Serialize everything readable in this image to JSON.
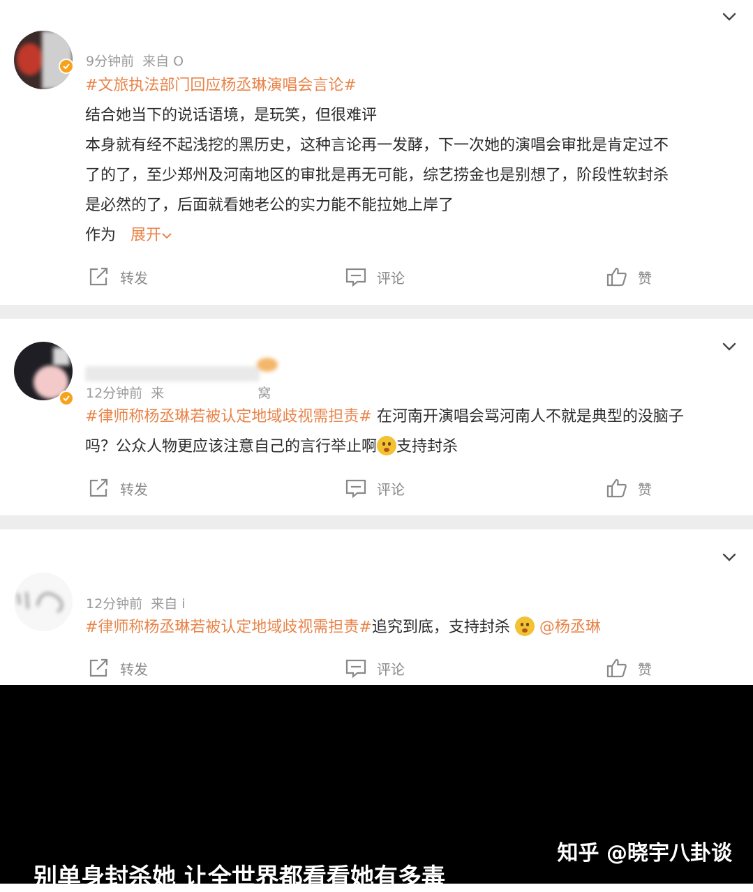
{
  "comments": [
    {
      "time": "9分钟前",
      "source": "来自 O",
      "hashtag": "#文旅执法部门回应杨丞琳演唱会言论#",
      "lines": [
        "结合她当下的说话语境，是玩笑，但很难评",
        "本身就有经不起浅挖的黑历史，这种言论再一发酵，下一次她的演唱会审批是肯定过不",
        "了的了，至少郑州及河南地区的审批是再无可能，综艺捞金也是别想了，阶段性软封杀",
        "是必然的了，后面就看她老公的实力能不能拉她上岸了"
      ],
      "truncated_prefix": "作为",
      "expand_label": "展开",
      "actions": {
        "repost": "转发",
        "comment": "评论",
        "like": "赞"
      }
    },
    {
      "time": "12分钟前",
      "source": "来",
      "source_suffix": "窝",
      "hashtag": "#律师称杨丞琳若被认定地域歧视需担责#",
      "body_line1": " 在河南开演唱会骂河南人不就是典型的没脑子",
      "body_line2a": "吗？公众人物更应该注意自己的言行举止啊",
      "body_line2b": "支持封杀",
      "actions": {
        "repost": "转发",
        "comment": "评论",
        "like": "赞"
      }
    },
    {
      "time": "12分钟前",
      "source": "来自 i",
      "hashtag": "#律师称杨丞琳若被认定地域歧视需担责#",
      "body": "追究到底，支持封杀",
      "mention": "@杨丞琳",
      "actions": {
        "repost": "转发",
        "comment": "评论",
        "like": "赞"
      }
    }
  ],
  "watermark": "知乎 @晓宇八卦谈",
  "subtitle": "别单身封杀她 让全世界都看看她有多毒",
  "colors": {
    "accent": "#e8844a",
    "badge": "#f7a21b",
    "separator": "#ededed",
    "muted": "#9a9a9a"
  },
  "icons": [
    "chevron-down-icon",
    "verified-badge-icon",
    "repost-icon",
    "comment-icon",
    "like-icon",
    "emoji-icon"
  ]
}
